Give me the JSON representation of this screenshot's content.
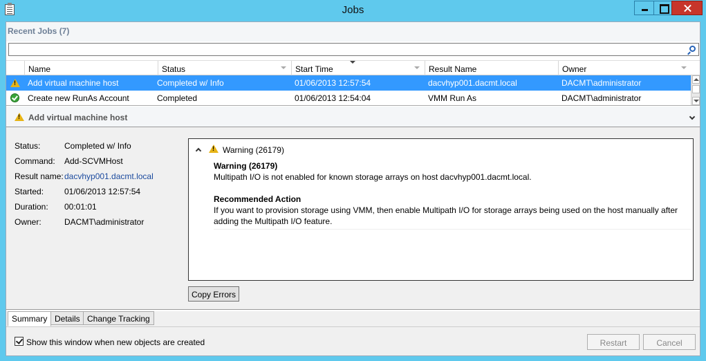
{
  "window": {
    "title": "Jobs"
  },
  "recent": {
    "header": "Recent Jobs (7)",
    "search_value": ""
  },
  "grid": {
    "columns": [
      "Name",
      "Status",
      "Start Time",
      "Result Name",
      "Owner"
    ],
    "rows": [
      {
        "icon": "warning-icon",
        "name": "Add virtual machine host",
        "status": "Completed w/ Info",
        "start": "01/06/2013 12:57:54",
        "result": "dacvhyp001.dacmt.local",
        "owner": "DACMT\\administrator",
        "selected": true
      },
      {
        "icon": "success-icon",
        "name": "Create new RunAs Account",
        "status": "Completed",
        "start": "01/06/2013 12:54:04",
        "result": "VMM Run As",
        "owner": "DACMT\\administrator",
        "selected": false
      }
    ]
  },
  "detail": {
    "header": "Add virtual machine host",
    "props": [
      {
        "key": "Status:",
        "value": "Completed w/ Info"
      },
      {
        "key": "Command:",
        "value": "Add-SCVMHost"
      },
      {
        "key": "Result name:",
        "value": "dacvhyp001.dacmt.local"
      },
      {
        "key": "Started:",
        "value": "01/06/2013 12:57:54"
      },
      {
        "key": "Duration:",
        "value": "00:01:01"
      },
      {
        "key": "Owner:",
        "value": "DACMT\\administrator"
      }
    ],
    "error": {
      "title": "Warning (26179)",
      "heading": "Warning (26179)",
      "message": "Multipath I/O is not enabled for known storage arrays on host dacvhyp001.dacmt.local.",
      "action_heading": "Recommended Action",
      "action_line1": "If you want to provision storage using VMM, then enable Multipath I/O for storage arrays being used on the host manually after",
      "action_line2": "adding the Multipath I/O feature."
    },
    "copy_button": "Copy Errors"
  },
  "tabs": [
    "Summary",
    "Details",
    "Change Tracking"
  ],
  "footer": {
    "checkbox_label": "Show this window when new objects are created",
    "checkbox_checked": true,
    "restart": "Restart",
    "cancel": "Cancel"
  }
}
